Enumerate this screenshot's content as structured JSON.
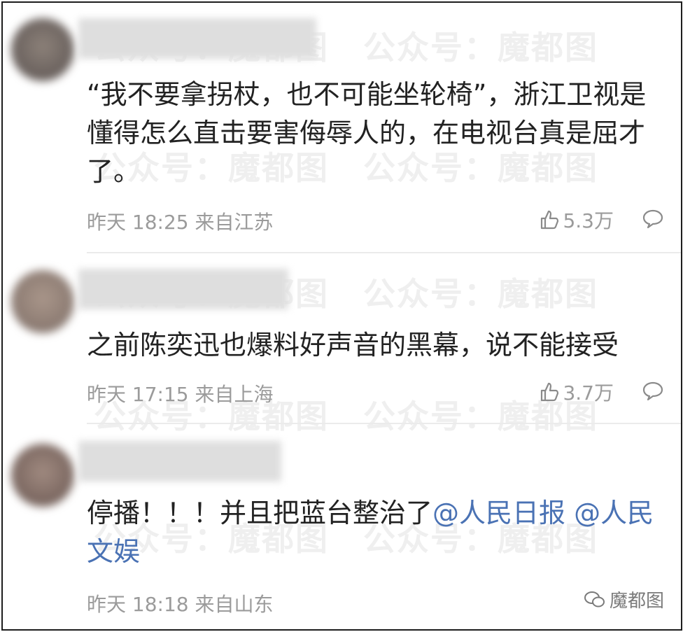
{
  "watermark": {
    "text": "公众号：魔都图"
  },
  "comments": [
    {
      "text": "“我不要拿拐杖，也不可能坐轮椅”，浙江卫视是懂得怎么直击要害侮辱人的，在电视台真是屈才了。",
      "time": "昨天 18:25",
      "location": "来自江苏",
      "likes": "5.3万"
    },
    {
      "text": "之前陈奕迅也爆料好声音的黑幕，说不能接受",
      "time": "昨天 17:15",
      "location": "来自上海",
      "likes": "3.7万"
    },
    {
      "text_prefix": "停播！！！并且把蓝台整治了",
      "mention1": "@人民日报",
      "mention2": "@人民文娱",
      "time": "昨天 18:18",
      "location": "来自山东"
    }
  ],
  "badge": {
    "text": "魔都图"
  },
  "colors": {
    "mention": "#4a72b4",
    "meta": "#9b9b9b",
    "text": "#222222"
  }
}
